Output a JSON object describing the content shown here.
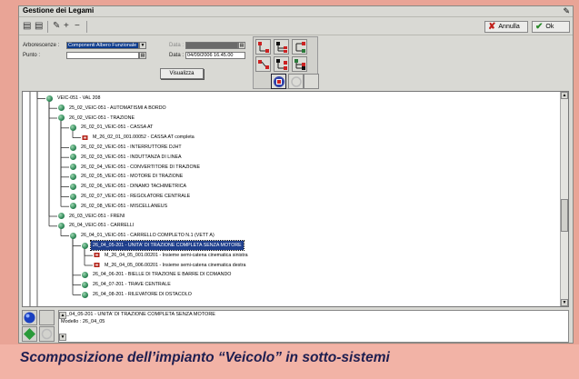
{
  "window": {
    "title": "Gestione dei Legami"
  },
  "buttons": {
    "annulla": "Annulla",
    "ok": "Ok",
    "visualizza": "Visualizza"
  },
  "form": {
    "arborescenze_label": "Arborescenze :",
    "arborescenze_value": "Componenti Albero Funzionale",
    "punto_label": "Punto :",
    "punto_value": "",
    "data_label_1": "Data :",
    "data_label_2": "Data :",
    "data_value_1": "",
    "data_value_2": "04/09/2006 16.45.00"
  },
  "tree": {
    "rows": [
      {
        "text": "VEIC-051 - VAL 208",
        "type": "node",
        "depth": 0,
        "selected": false
      },
      {
        "text": "25_02_VEIC-051 - AUTOMATISMI A BORDO",
        "type": "node",
        "depth": 1,
        "selected": false
      },
      {
        "text": "26_02_VEIC-051 - TRAZIONE",
        "type": "node",
        "depth": 1,
        "selected": false
      },
      {
        "text": "26_02_01_VEIC-051 - CASSA AT",
        "type": "node",
        "depth": 2,
        "selected": false
      },
      {
        "text": "M_26_02_01_001.00052 - CASSA AT completa",
        "type": "leaf",
        "depth": 3,
        "selected": false
      },
      {
        "text": "26_02_02_VEIC-051 - INTERRUTTORE DJHT",
        "type": "node",
        "depth": 2,
        "selected": false
      },
      {
        "text": "26_02_03_VEIC-051 - INDUTTANZA DI LINEA",
        "type": "node",
        "depth": 2,
        "selected": false
      },
      {
        "text": "26_02_04_VEIC-051 - CONVERTITORE DI TRAZIONE",
        "type": "node",
        "depth": 2,
        "selected": false
      },
      {
        "text": "26_02_05_VEIC-051 - MOTORE DI TRAZIONE",
        "type": "node",
        "depth": 2,
        "selected": false
      },
      {
        "text": "26_02_06_VEIC-051 - DINAMO TACHIMETRICA",
        "type": "node",
        "depth": 2,
        "selected": false
      },
      {
        "text": "26_02_07_VEIC-051 - REGOLATORE CENTRALE",
        "type": "node",
        "depth": 2,
        "selected": false
      },
      {
        "text": "26_02_08_VEIC-051 - MISCELLANEUS",
        "type": "node",
        "depth": 2,
        "selected": false
      },
      {
        "text": "26_03_VEIC-051 - FRENI",
        "type": "node",
        "depth": 1,
        "selected": false
      },
      {
        "text": "26_04_VEIC-051 - CARRELLI",
        "type": "node",
        "depth": 1,
        "selected": false
      },
      {
        "text": "26_04_01_VEIC-051 - CARRELLO COMPLETO N.1 (VETT A)",
        "type": "node",
        "depth": 2,
        "selected": false
      },
      {
        "text": "26_04_05-201 - UNITA' DI TRAZIONE COMPLETA SENZA MOTORE",
        "type": "node",
        "depth": 3,
        "selected": true
      },
      {
        "text": "M_26_04_05_001.00201 - Insieme semi-catena cinematica sinistra",
        "type": "leaf",
        "depth": 4,
        "selected": false
      },
      {
        "text": "M_26_04_05_006.00201 - Insieme semi-catena cinematica destra",
        "type": "leaf",
        "depth": 4,
        "selected": false
      },
      {
        "text": "26_04_06-201 - BIELLE DI TRAZIONE E BARRE DI COMANDO",
        "type": "node",
        "depth": 3,
        "selected": false
      },
      {
        "text": "26_04_07-201 - TRAVE CENTRALE",
        "type": "node",
        "depth": 3,
        "selected": false
      },
      {
        "text": "26_04_08-201 - RILEVATORE DI OSTACOLO",
        "type": "node",
        "depth": 3,
        "selected": false
      }
    ]
  },
  "info": {
    "line1": "26_04_05-201 - UNITA' DI TRAZIONE COMPLETA SENZA MOTORE",
    "line2": "Modello : 26_04_05"
  },
  "caption": {
    "text": "Scomposizione dell’impianto “Veicolo” in sotto-sistemi"
  },
  "colors": {
    "background": "#e9a496",
    "caption_band": "#f2b3a6",
    "caption_text": "#1e1e50",
    "selection": "#1f3f8c",
    "node_green": "#2f8a58"
  }
}
